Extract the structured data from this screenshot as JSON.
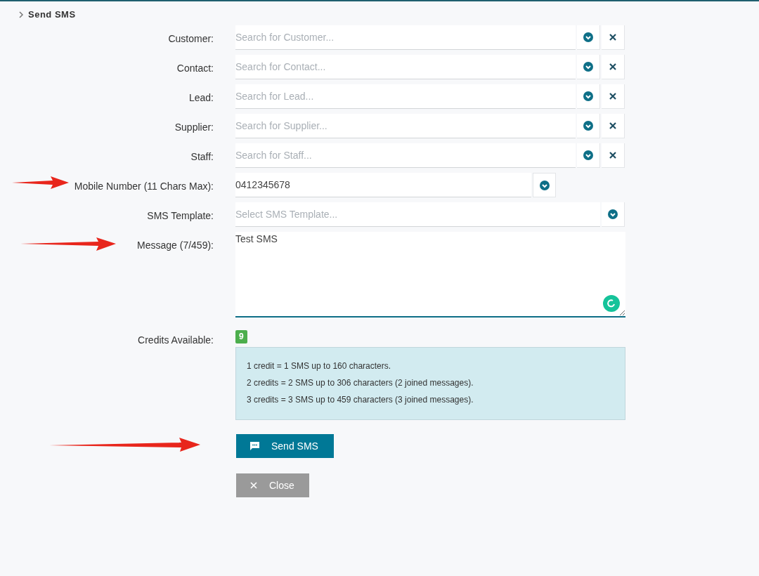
{
  "header": {
    "title": "Send SMS"
  },
  "fields": [
    {
      "label": "Customer:",
      "kind": "search",
      "placeholder": "Search for Customer..."
    },
    {
      "label": "Contact:",
      "kind": "search",
      "placeholder": "Search for Contact..."
    },
    {
      "label": "Lead:",
      "kind": "search",
      "placeholder": "Search for Lead..."
    },
    {
      "label": "Supplier:",
      "kind": "search",
      "placeholder": "Search for Supplier..."
    },
    {
      "label": "Staff:",
      "kind": "search",
      "placeholder": "Search for Staff..."
    },
    {
      "label": "Mobile Number (11 Chars Max):",
      "kind": "phone",
      "value": "0412345678"
    },
    {
      "label": "SMS Template:",
      "kind": "select",
      "placeholder": "Select SMS Template..."
    },
    {
      "label": "Message (7/459):",
      "kind": "textarea",
      "value": "Test SMS"
    }
  ],
  "credits": {
    "label": "Credits Available:",
    "count": "9",
    "notes": [
      "1 credit = 1 SMS up to 160 characters.",
      "2 credits = 2 SMS up to 306 characters (2 joined messages).",
      "3 credits = 3 SMS up to 459 characters (3 joined messages)."
    ]
  },
  "buttons": [
    {
      "label": "Send SMS",
      "kind": "primary"
    },
    {
      "label": "Close",
      "kind": "secondary"
    }
  ]
}
